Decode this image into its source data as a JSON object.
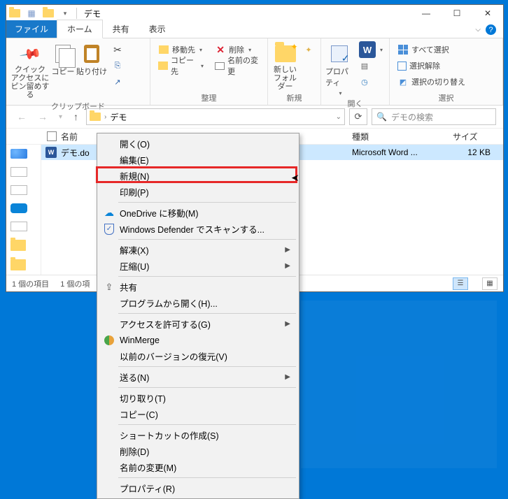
{
  "titlebar": {
    "title": "デモ"
  },
  "winctrl": {
    "min": "—",
    "max": "☐",
    "close": "✕"
  },
  "tabs": {
    "file": "ファイル",
    "home": "ホーム",
    "share": "共有",
    "view": "表示"
  },
  "ribbon": {
    "clipboard": {
      "pin": "クイック アクセスにピン留めする",
      "copy": "コピー",
      "paste": "貼り付け",
      "cut": "切り取り",
      "copypath": "パスのコピー",
      "shortcut": "ショートカットの貼り付け",
      "label": "クリップボード"
    },
    "organize": {
      "moveto": "移動先",
      "copyto": "コピー先",
      "delete": "削除",
      "rename": "名前の変更",
      "label": "整理"
    },
    "new": {
      "newfolder": "新しいフォルダー",
      "label": "新規"
    },
    "open": {
      "properties": "プロパティ",
      "label": "開く"
    },
    "select": {
      "all": "すべて選択",
      "none": "選択解除",
      "invert": "選択の切り替え",
      "label": "選択"
    }
  },
  "address": {
    "path": "デモ",
    "search_placeholder": "デモの検索"
  },
  "columns": {
    "name": "名前",
    "type": "種類",
    "size": "サイズ"
  },
  "file": {
    "name": "デモ.do",
    "type": "Microsoft Word ...",
    "size": "12 KB"
  },
  "status": {
    "items": "1 個の項目",
    "selected": "1 個の項"
  },
  "context_menu": {
    "open": "開く(O)",
    "edit": "編集(E)",
    "new": "新規(N)",
    "print": "印刷(P)",
    "onedrive": "OneDrive に移動(M)",
    "defender": "Windows Defender でスキャンする...",
    "extract": "解凍(X)",
    "compress": "圧縮(U)",
    "share": "共有",
    "openwith": "プログラムから開く(H)...",
    "grantaccess": "アクセスを許可する(G)",
    "winmerge": "WinMerge",
    "restore": "以前のバージョンの復元(V)",
    "sendto": "送る(N)",
    "cut": "切り取り(T)",
    "copy": "コピー(C)",
    "shortcut": "ショートカットの作成(S)",
    "delete": "削除(D)",
    "rename": "名前の変更(M)",
    "properties": "プロパティ(R)"
  }
}
